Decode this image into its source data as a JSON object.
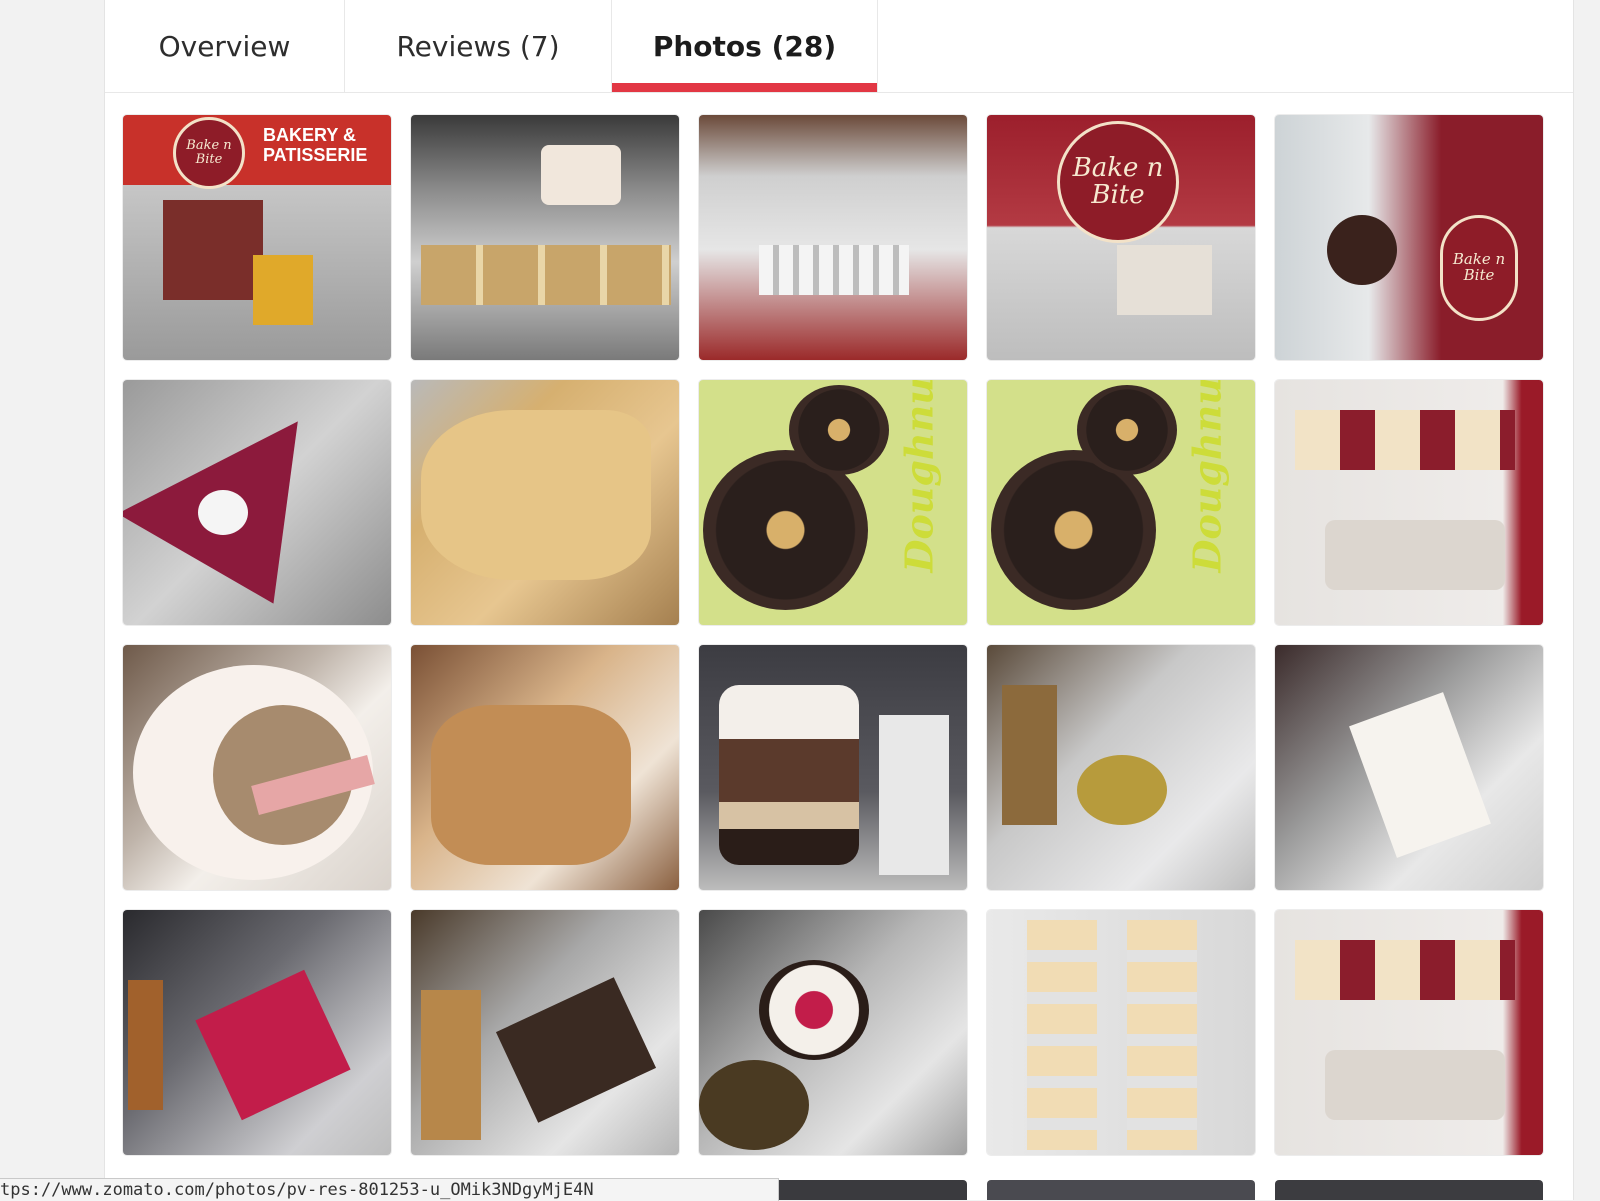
{
  "tabs": [
    {
      "label": "Overview",
      "active": false
    },
    {
      "label": "Reviews (7)",
      "active": false
    },
    {
      "label": "Photos (28)",
      "active": true
    }
  ],
  "photos": {
    "storefront_sign": "BAKERY & PATISSERIE",
    "logo_text": "Bake n Bite",
    "doughnut_text": "Doughnuts"
  },
  "status_url": "tps://www.zomato.com/photos/pv-res-801253-u_OMik3NDgyMjE4N",
  "colors": {
    "accent": "#e23744"
  }
}
